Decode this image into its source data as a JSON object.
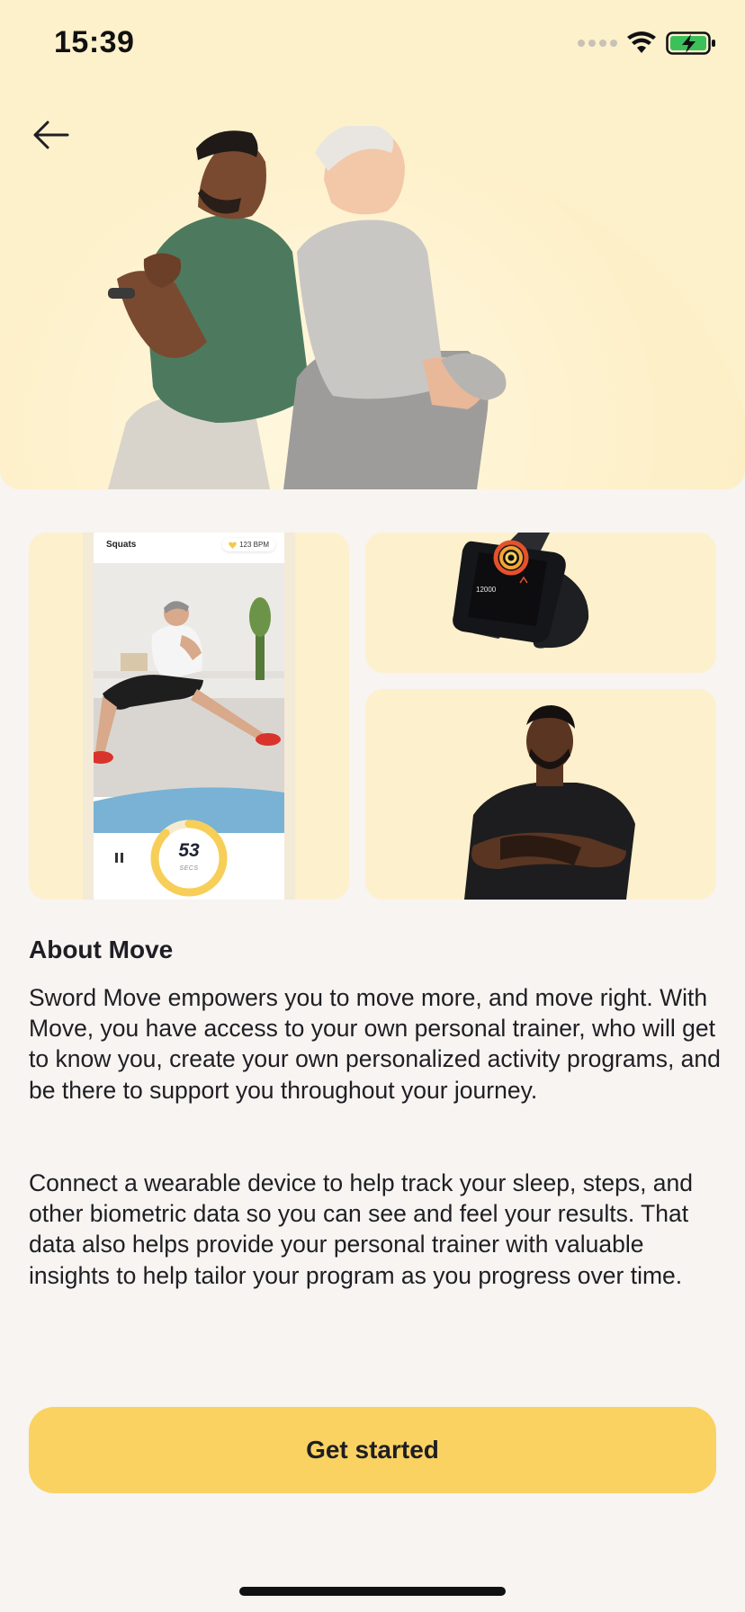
{
  "status_bar": {
    "time": "15:39"
  },
  "gallery": {
    "exercise_name": "Squats",
    "heart_rate": "123 BPM",
    "timer_value": "53",
    "timer_unit": "SECS",
    "timer_progress": 0.88,
    "watch_readout": "12000"
  },
  "about": {
    "title": "About Move",
    "paragraph_1": "Sword Move empowers you to move more, and move right. With Move, you have access to your own personal trainer, who will get to know you, create your own personalized activity programs, and be there to support you throughout your journey.",
    "paragraph_2": "Connect a wearable device to help track your sleep, steps, and other biometric data so you can see and feel your results. That data also helps provide your personal trainer with valuable insights to help tailor your program as you progress over time."
  },
  "cta": {
    "label": "Get started"
  },
  "colors": {
    "accent": "#fad262",
    "hero_bg": "#fdf1cc",
    "page_bg": "#f7f4f1",
    "text": "#1e1e24"
  }
}
